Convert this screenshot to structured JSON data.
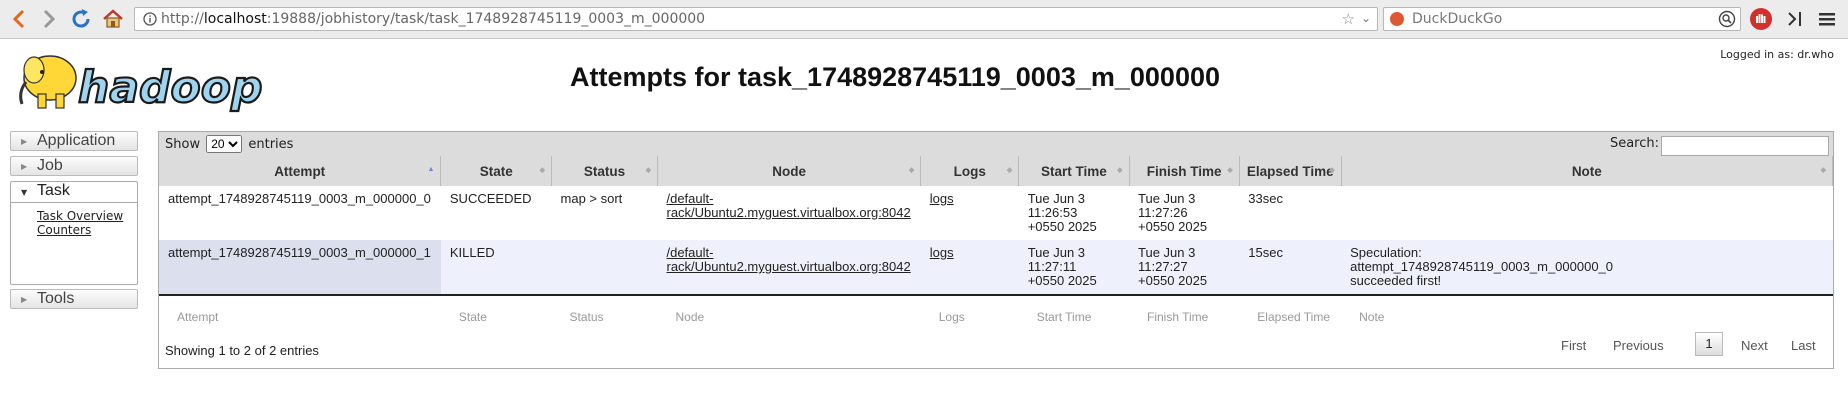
{
  "browser": {
    "url_prefix": "http://",
    "url_host": "localhost",
    "url_rest": ":19888/jobhistory/task/task_1748928745119_0003_m_000000",
    "search_placeholder": "DuckDuckGo"
  },
  "header": {
    "logged_in": "Logged in as: dr.who",
    "title": "Attempts for task_1748928745119_0003_m_000000"
  },
  "sidebar": {
    "application": "Application",
    "job": "Job",
    "task": "Task",
    "task_links": [
      "Task Overview",
      "Counters"
    ],
    "tools": "Tools"
  },
  "table": {
    "show_label": "Show",
    "entries_label": "entries",
    "page_size": "20",
    "search_label": "Search:",
    "columns": [
      "Attempt",
      "State",
      "Status",
      "Node",
      "Logs",
      "Start Time",
      "Finish Time",
      "Elapsed Time",
      "Note"
    ],
    "rows": [
      {
        "attempt": "attempt_1748928745119_0003_m_000000_0",
        "state": "SUCCEEDED",
        "status": "map > sort",
        "node_1": "/default-",
        "node_2": "rack/Ubuntu2.myguest.virtualbox.org:8042",
        "logs": "logs",
        "start_1": "Tue Jun 3 11:26:53",
        "start_2": "+0550 2025",
        "finish_1": "Tue Jun 3 11:27:26",
        "finish_2": "+0550 2025",
        "elapsed": "33sec",
        "note_1": "",
        "note_2": "",
        "note_3": ""
      },
      {
        "attempt": "attempt_1748928745119_0003_m_000000_1",
        "state": "KILLED",
        "status": "",
        "node_1": "/default-",
        "node_2": "rack/Ubuntu2.myguest.virtualbox.org:8042",
        "logs": "logs",
        "start_1": "Tue Jun 3 11:27:11",
        "start_2": "+0550 2025",
        "finish_1": "Tue Jun 3 11:27:27",
        "finish_2": "+0550 2025",
        "elapsed": "15sec",
        "note_1": "Speculation:",
        "note_2": "attempt_1748928745119_0003_m_000000_0",
        "note_3": "succeeded first!"
      }
    ],
    "footer": [
      "Attempt",
      "State",
      "Status",
      "Node",
      "Logs",
      "Start Time",
      "Finish Time",
      "Elapsed Time",
      "Note"
    ],
    "info": "Showing 1 to 2 of 2 entries",
    "pager": {
      "first": "First",
      "previous": "Previous",
      "current": "1",
      "next": "Next",
      "last": "Last"
    }
  }
}
